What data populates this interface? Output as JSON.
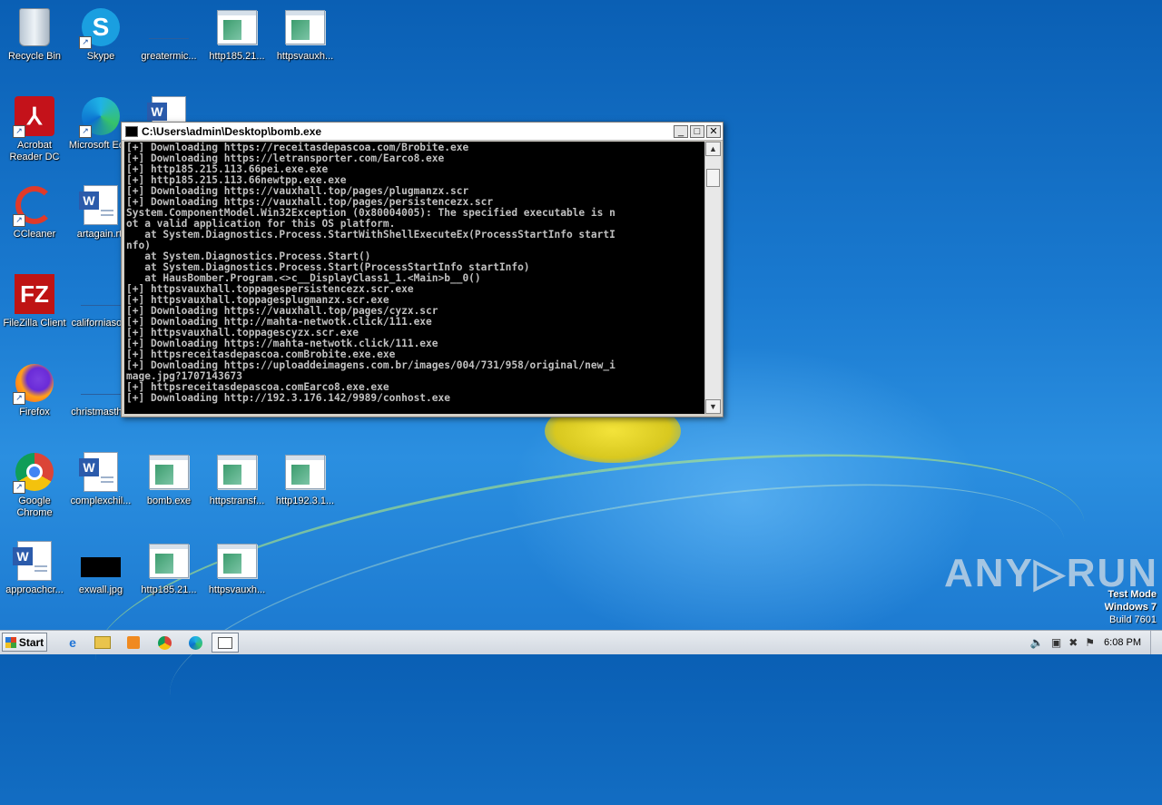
{
  "desktop": {
    "icons": [
      {
        "label": "Recycle Bin",
        "icon": "recycle-bin-icon"
      },
      {
        "label": "Skype",
        "icon": "skype-icon"
      },
      {
        "label": "greatermic...",
        "icon": "blank-file-icon"
      },
      {
        "label": "http185.21...",
        "icon": "exe-file-icon"
      },
      {
        "label": "httpsvauxh...",
        "icon": "exe-file-icon"
      },
      {
        "label": "Acrobat Reader DC",
        "icon": "acrobat-icon"
      },
      {
        "label": "Microsoft Ed...",
        "icon": "edge-icon"
      },
      {
        "label": "CCleaner",
        "icon": "ccleaner-icon"
      },
      {
        "label": "artagain.rtf",
        "icon": "word-doc-icon"
      },
      {
        "label": "FileZilla Client",
        "icon": "filezilla-icon"
      },
      {
        "label": "californiaso...",
        "icon": "blank-file-icon"
      },
      {
        "label": "Firefox",
        "icon": "firefox-icon"
      },
      {
        "label": "christmasth...",
        "icon": "blank-file-icon"
      },
      {
        "label": "Google Chrome",
        "icon": "chrome-icon"
      },
      {
        "label": "complexchil...",
        "icon": "word-doc-icon"
      },
      {
        "label": "bomb.exe",
        "icon": "exe-file-icon"
      },
      {
        "label": "httpstransf...",
        "icon": "exe-file-icon"
      },
      {
        "label": "http192.3.1...",
        "icon": "exe-file-icon"
      },
      {
        "label": "approachcr...",
        "icon": "word-doc-icon"
      },
      {
        "label": "exwall.jpg",
        "icon": "image-file-icon"
      },
      {
        "label": "http185.21...",
        "icon": "exe-file-icon"
      },
      {
        "label": "httpsvauxh...",
        "icon": "exe-file-icon"
      }
    ]
  },
  "console": {
    "title": "C:\\Users\\admin\\Desktop\\bomb.exe",
    "minimize": "_",
    "maximize": "□",
    "close": "✕",
    "lines": [
      "[+] Downloading https://receitasdepascoa.com/Brobite.exe",
      "[+] Downloading https://letransporter.com/Earco8.exe",
      "[+] http185.215.113.66pei.exe.exe",
      "[+] http185.215.113.66newtpp.exe.exe",
      "[+] Downloading https://vauxhall.top/pages/plugmanzx.scr",
      "[+] Downloading https://vauxhall.top/pages/persistencezx.scr",
      "System.ComponentModel.Win32Exception (0x80004005): The specified executable is n",
      "ot a valid application for this OS platform.",
      "   at System.Diagnostics.Process.StartWithShellExecuteEx(ProcessStartInfo startI",
      "nfo)",
      "   at System.Diagnostics.Process.Start()",
      "   at System.Diagnostics.Process.Start(ProcessStartInfo startInfo)",
      "   at HausBomber.Program.<>c__DisplayClass1_1.<Main>b__0()",
      "[+] httpsvauxhall.toppagespersistencezx.scr.exe",
      "[+] httpsvauxhall.toppagesplugmanzx.scr.exe",
      "[+] Downloading https://vauxhall.top/pages/cyzx.scr",
      "[+] Downloading http://mahta-netwotk.click/111.exe",
      "[+] httpsvauxhall.toppagescyzx.scr.exe",
      "[+] Downloading https://mahta-netwotk.click/111.exe",
      "[+] httpsreceitasdepascoa.comBrobite.exe.exe",
      "[+] Downloading https://uploaddeimagens.com.br/images/004/731/958/original/new_i",
      "mage.jpg?1707143673",
      "[+] httpsreceitasdepascoa.comEarco8.exe.exe",
      "[+] Downloading http://192.3.176.142/9989/conhost.exe"
    ]
  },
  "watermark": "ANY▷RUN",
  "os": {
    "mode": "Test Mode",
    "name": "Windows 7",
    "build": "Build 7601"
  },
  "taskbar": {
    "start_label": "Start",
    "clock": "6:08 PM"
  }
}
